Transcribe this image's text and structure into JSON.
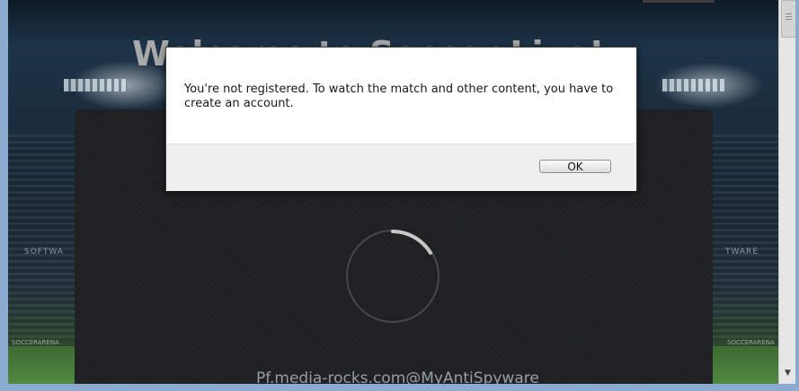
{
  "page": {
    "headline": "Welcome to Soccer Live!",
    "watermark": "Pf.media-rocks.com@MyAntiSpyware",
    "side_text_left": "SOFTWA",
    "side_text_right": "TWARE",
    "arena_ad": "SOCCERARENA"
  },
  "dialog": {
    "message": "You're not registered. To watch the match and other content, you have to create an account.",
    "ok_label": "OK"
  },
  "colors": {
    "dialog_bg": "#ffffff",
    "footer_bg": "#efefef",
    "player_bg": "#1f2022",
    "window_frame": "#8aaad0"
  },
  "icons": {
    "loading": "loading-spinner-icon",
    "scroll_down": "arrow-down-icon"
  }
}
